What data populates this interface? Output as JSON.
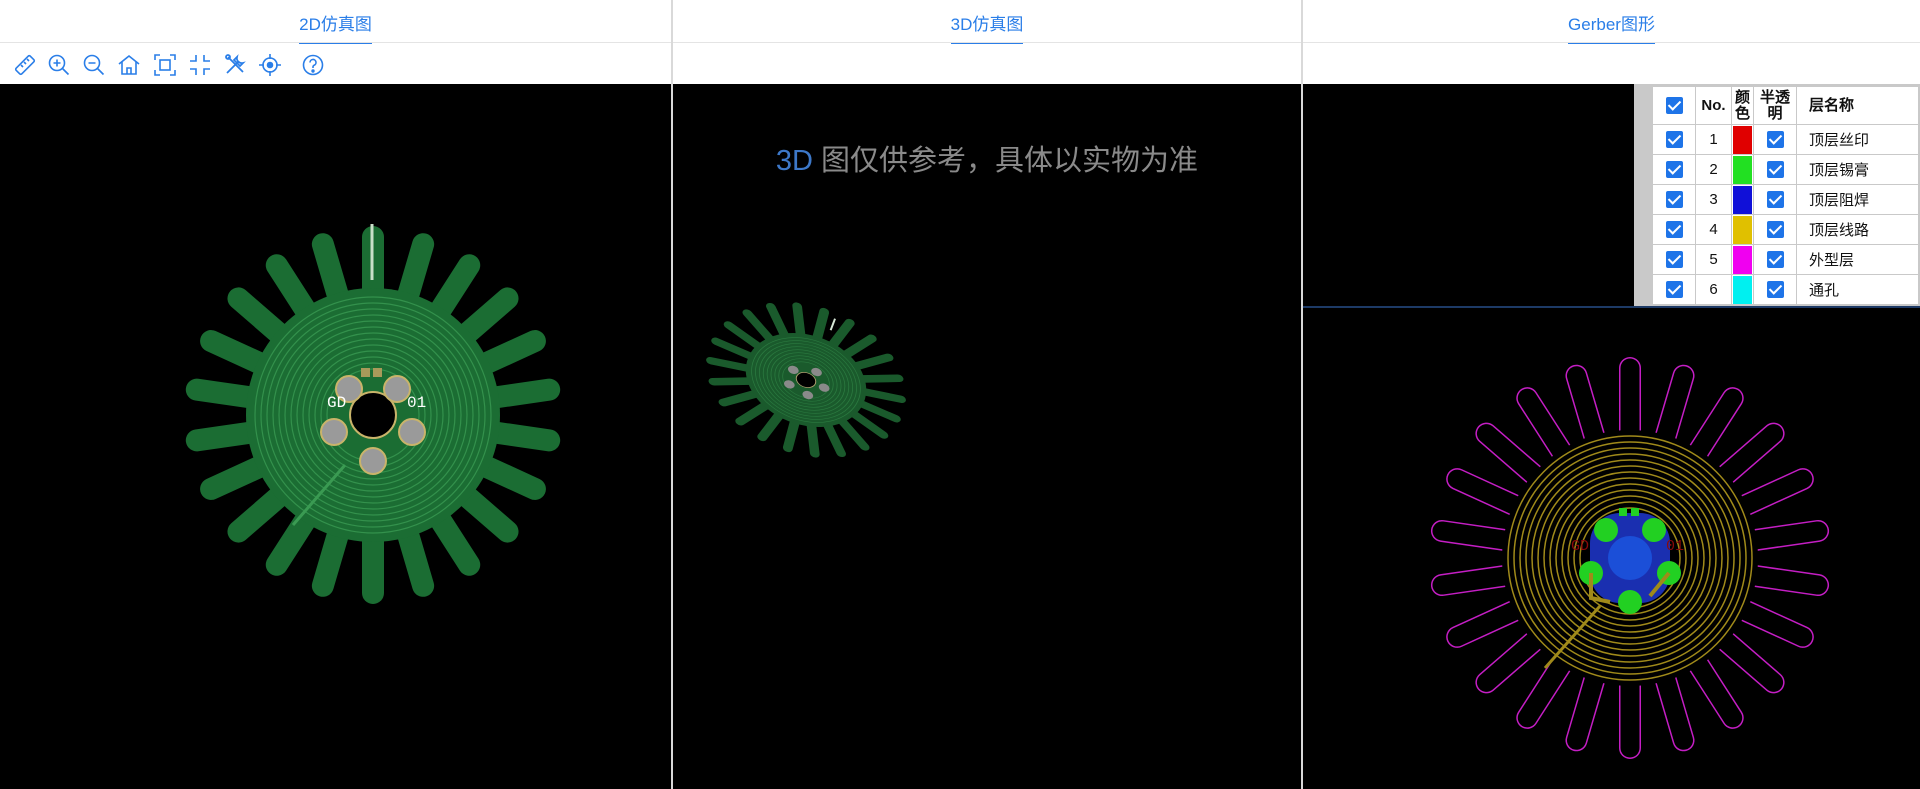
{
  "panels": {
    "sim2d": {
      "tab_label": "2D仿真图"
    },
    "sim3d": {
      "tab_label": "3D仿真图",
      "note_prefix": "3D",
      "note_text": " 图仅供参考，具体以实物为准"
    },
    "gerber": {
      "tab_label": "Gerber图形"
    }
  },
  "toolbar": {
    "tools": [
      {
        "name": "measure-ruler-icon"
      },
      {
        "name": "zoom-in-icon"
      },
      {
        "name": "zoom-out-icon"
      },
      {
        "name": "home-icon"
      },
      {
        "name": "fit-view-icon"
      },
      {
        "name": "exit-fullscreen-icon"
      },
      {
        "name": "tools-icon"
      },
      {
        "name": "locate-target-icon"
      },
      {
        "name": "help-icon"
      }
    ]
  },
  "board_labels": {
    "left": "GD",
    "right": "01"
  },
  "layers": {
    "headers": {
      "number": "No.",
      "color": "颜色",
      "translucent": "半透明",
      "name": "层名称"
    },
    "rows": [
      {
        "no": "1",
        "color": "#e00000",
        "name": "顶层丝印"
      },
      {
        "no": "2",
        "color": "#22e022",
        "name": "顶层锡膏"
      },
      {
        "no": "3",
        "color": "#1010d8",
        "name": "顶层阻焊"
      },
      {
        "no": "4",
        "color": "#e0c000",
        "name": "顶层线路"
      },
      {
        "no": "5",
        "color": "#f000f0",
        "name": "外型层"
      },
      {
        "no": "6",
        "color": "#00f0f0",
        "name": "通孔"
      }
    ]
  },
  "colors": {
    "accent": "#2a7ee8",
    "board_green": "#1b6d33",
    "trace_green": "#3a9a52",
    "outline_magenta": "#c41ec4",
    "trace_gold": "#a08a1a",
    "pad_green": "#22d022",
    "hole_blue": "#1b4fd8"
  }
}
